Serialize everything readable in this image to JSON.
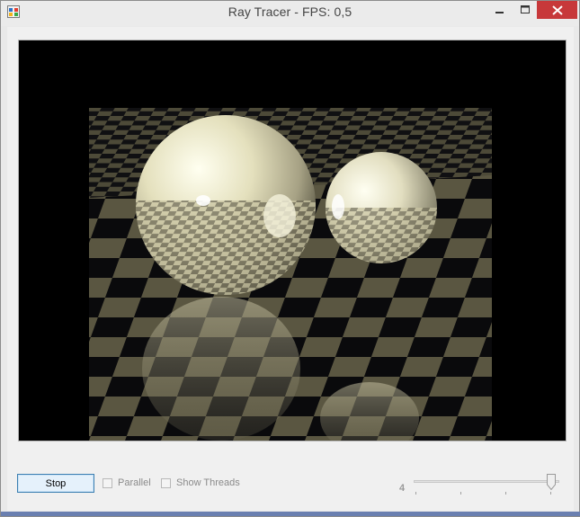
{
  "window": {
    "title": "Ray Tracer - FPS: 0,5",
    "controls": {
      "minimize": "minimize-icon",
      "maximize": "maximize-icon",
      "close": "close-icon"
    },
    "accent_close": "#c7383a"
  },
  "controls": {
    "stop_label": "Stop",
    "parallel_label": "Parallel",
    "parallel_checked": false,
    "show_threads_label": "Show Threads",
    "show_threads_checked": false,
    "thread_count_value": "4",
    "slider_level": 1.0
  },
  "render": {
    "scene": "ray-traced-spheres-on-checkerboard"
  }
}
